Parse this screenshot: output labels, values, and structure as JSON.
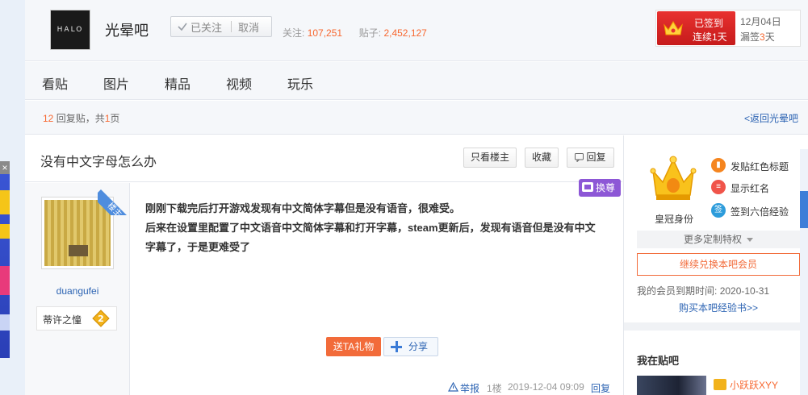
{
  "header": {
    "logo_text": "HALO",
    "forum_name": "光晕吧",
    "follow_state": "已关注",
    "cancel_label": "取消",
    "followers_label": "关注:",
    "followers_count": "107,251",
    "posts_label": "贴子:",
    "posts_count": "2,452,127"
  },
  "signin": {
    "status": "已签到",
    "streak": "连续1天",
    "date": "12月04日",
    "missed_prefix": "漏签",
    "missed_count": "3",
    "missed_suffix": "天"
  },
  "nav": {
    "items": [
      "看贴",
      "图片",
      "精品",
      "视频",
      "玩乐"
    ]
  },
  "pager": {
    "replies_count": "12",
    "replies_label": "回复贴，共",
    "pages_count": "1",
    "pages_label": "页",
    "back_link": "<返回光晕吧"
  },
  "thread": {
    "title": "没有中文字母怎么办",
    "only_op_label": "只看楼主",
    "favorite_label": "收藏",
    "reply_label": "回复"
  },
  "post": {
    "ribbon": "楼主",
    "swap_badge": "换尊",
    "author_name": "duangufei",
    "level_title": "蒂许之憧",
    "level_number": "2",
    "content_line1": "刚刚下载完后打开游戏发现有中文简体字幕但是没有语音，很难受。",
    "content_line2": "后来在设置里配置了中文语音中文简体字幕和打开字幕，steam更新后，发现有语音但是没有中文字幕了，于是更难受了",
    "gift_label": "送TA礼物",
    "share_label": "分享",
    "report_label": "举报",
    "floor": "1楼",
    "timestamp": "2019-12-04 09:09",
    "reply_label": "回复"
  },
  "sidebar": {
    "crown_label": "皇冠身份",
    "perks": [
      {
        "label": "发贴红色标题",
        "icon": "title-icon",
        "color": "#f5851f"
      },
      {
        "label": "显示红名",
        "icon": "name-icon",
        "color": "#f0544a"
      },
      {
        "label": "签到六倍经验",
        "icon": "sign-icon",
        "color": "#2d9cdb"
      }
    ],
    "sign_icon_text": "签",
    "more_perks": "更多定制特权",
    "continue_label": "继续兑换本吧会员",
    "expire_label": "我的会员到期时间:",
    "expire_date": "2020-10-31",
    "buy_link": "购买本吧经验书>>",
    "mybar_title": "我在贴吧",
    "mybar_user": "小跃跃XYY"
  },
  "colors": {
    "accent_orange": "#f7672f",
    "link_blue": "#2d64b3",
    "signin_red": "#d32222"
  }
}
